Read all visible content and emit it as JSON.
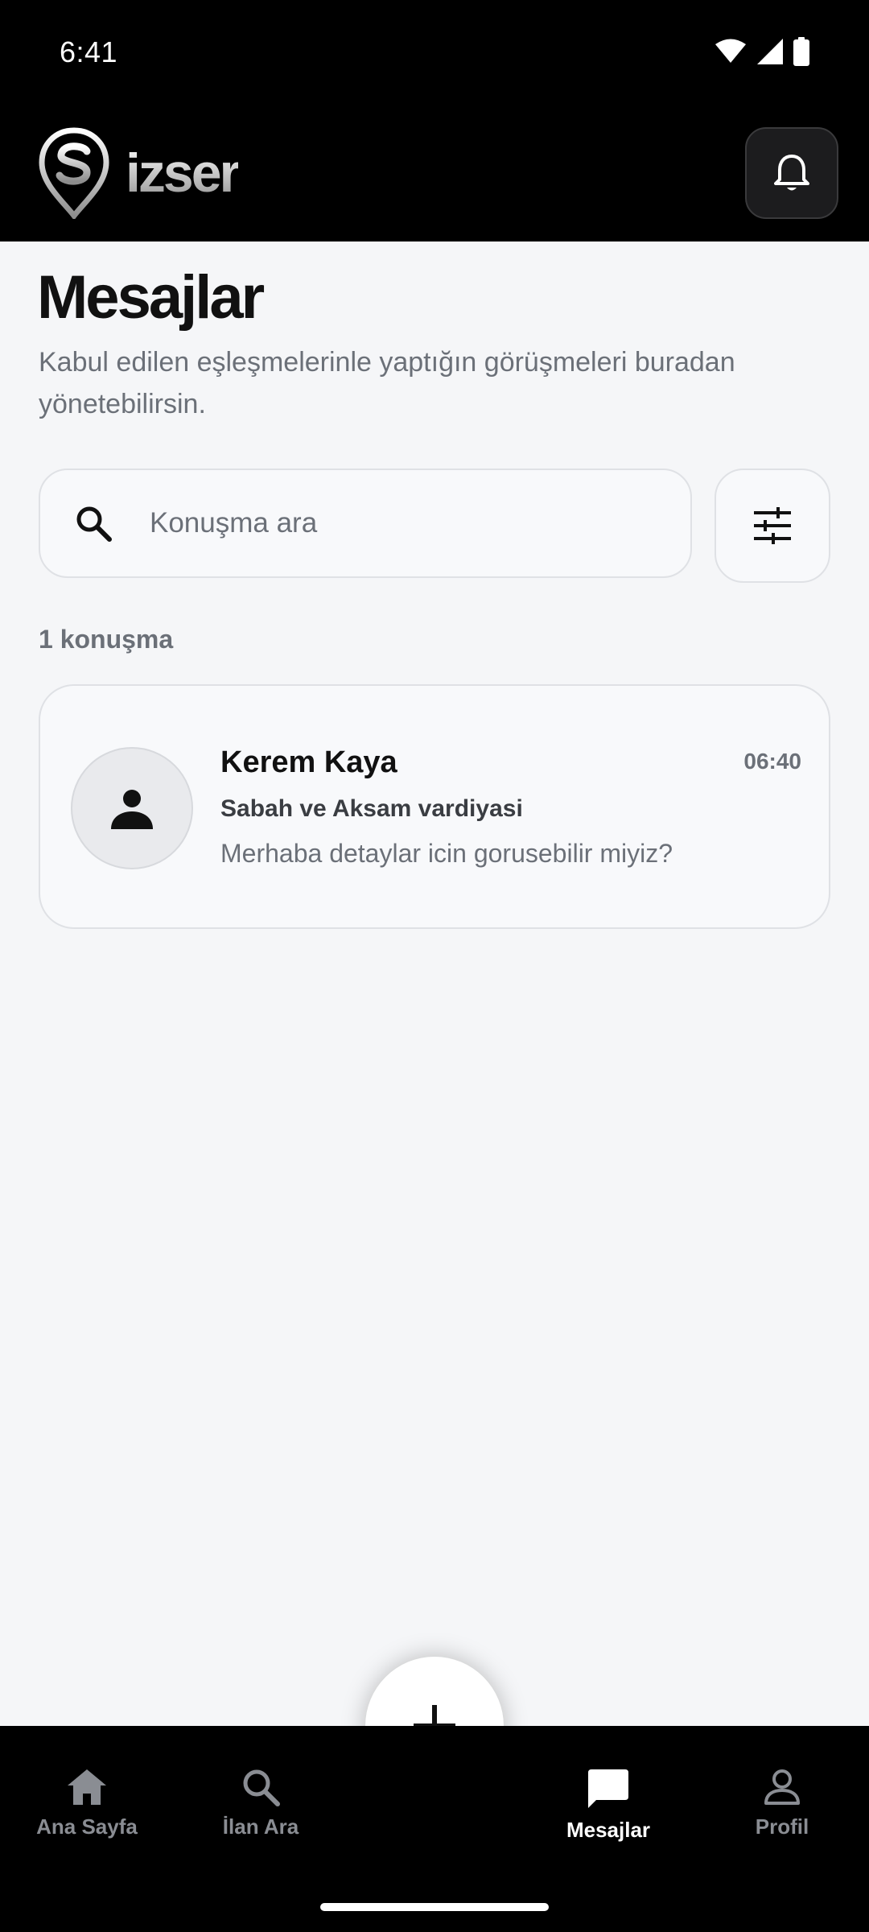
{
  "status_bar": {
    "time": "6:41"
  },
  "header": {
    "logo_text": "izser"
  },
  "page": {
    "title": "Mesajlar",
    "subtitle": "Kabul edilen eşleşmelerinle yaptığın görüşmeleri buradan yönetebilirsin."
  },
  "search": {
    "placeholder": "Konuşma ara",
    "value": ""
  },
  "list": {
    "count_label": "1 konuşma",
    "conversations": [
      {
        "name": "Kerem Kaya",
        "time": "06:40",
        "title": "Sabah ve Aksam vardiyasi",
        "message": "Merhaba detaylar icin gorusebilir miyiz?"
      }
    ]
  },
  "nav": {
    "items": [
      {
        "label": "Ana Sayfa",
        "icon": "home-icon",
        "active": false
      },
      {
        "label": "İlan Ara",
        "icon": "search-icon",
        "active": false
      },
      {
        "label": "Mesajlar",
        "icon": "chat-icon",
        "active": true
      },
      {
        "label": "Profil",
        "icon": "person-icon",
        "active": false
      }
    ],
    "fab_icon": "plus-icon"
  },
  "colors": {
    "header_bg": "#000000",
    "page_bg": "#f5f6f8",
    "muted_text": "#6b7078",
    "active_nav": "#ffffff",
    "inactive_nav": "#8a8d93"
  }
}
